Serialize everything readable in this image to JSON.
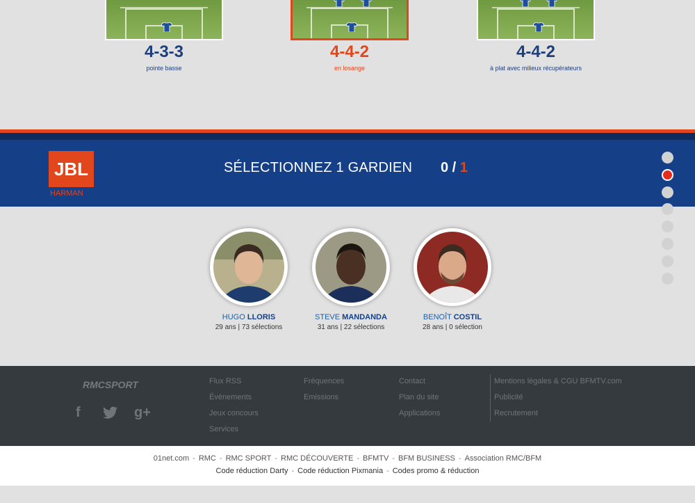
{
  "formations": [
    {
      "title": "4-3-3",
      "subtitle": "pointe basse",
      "selected": false
    },
    {
      "title": "4-4-2",
      "subtitle": "en losange",
      "selected": true
    },
    {
      "title": "4-4-2",
      "subtitle": "à plat avec milieux récupérateurs",
      "selected": false
    }
  ],
  "brand": {
    "logo_text": "JBL",
    "sub_text": "HARMAN"
  },
  "selection": {
    "title": "SÉLECTIONNEZ 1 GARDIEN",
    "current": "0",
    "separator": " / ",
    "max": "1"
  },
  "nav_dots": {
    "count": 8,
    "active_index": 1
  },
  "players": [
    {
      "first": "HUGO",
      "last": "LLORIS",
      "info": "29 ans | 73 sélections"
    },
    {
      "first": "STEVE",
      "last": "MANDANDA",
      "info": "31 ans | 22 sélections"
    },
    {
      "first": "BENOÎT",
      "last": "COSTIL",
      "info": "28 ans | 0 sélection"
    }
  ],
  "footer": {
    "logo": "RMCSPORT",
    "social": [
      "f",
      "twitter-bird",
      "g+"
    ],
    "col1": [
      "Flux RSS",
      "Évènements",
      "Jeux concours",
      "Services"
    ],
    "col2": [
      "Fréquences",
      "Emissions"
    ],
    "col3": [
      "Contact",
      "Plan du site",
      "Applications"
    ],
    "col4": [
      "Mentions légales & CGU BFMTV.com",
      "Publicité",
      "Recrutement"
    ]
  },
  "bottom": {
    "row1": [
      "01net.com",
      "RMC",
      "RMC SPORT",
      "RMC DÉCOUVERTE",
      "BFMTV",
      "BFM BUSINESS",
      "Association RMC/BFM"
    ],
    "row2": [
      "Code réduction Darty",
      "Code réduction Pixmania",
      "Codes promo & réduction"
    ]
  },
  "colors": {
    "accent": "#e2461c",
    "navy": "#153f87",
    "footer_bg": "#343a3d"
  }
}
